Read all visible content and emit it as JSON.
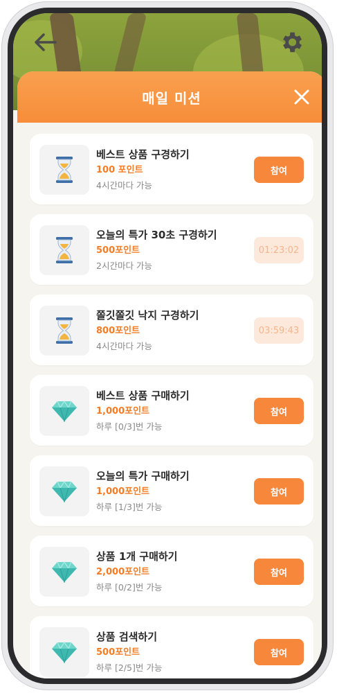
{
  "header": {
    "title": "매일 미션"
  },
  "missions": [
    {
      "icon": "hourglass",
      "title": "베스트 상품 구경하기",
      "points": "100 포인트",
      "availability": "4시간마다 가능",
      "action": "참여",
      "state": "join"
    },
    {
      "icon": "hourglass",
      "title": "오늘의 특가 30초 구경하기",
      "points": "500포인트",
      "availability": "2시간마다 가능",
      "action": "01:23:02",
      "state": "timer"
    },
    {
      "icon": "hourglass",
      "title": "쫄깃쫄깃 낙지 구경하기",
      "points": "800포인트",
      "availability": "4시간마다 가능",
      "action": "03:59:43",
      "state": "timer"
    },
    {
      "icon": "diamond",
      "title": "베스트 상품 구매하기",
      "points": "1,000포인트",
      "availability": "하루 [0/3]번 가능",
      "action": "참여",
      "state": "join"
    },
    {
      "icon": "diamond",
      "title": "오늘의 특가 구매하기",
      "points": "1,000포인트",
      "availability": "하루 [1/3]번 가능",
      "action": "참여",
      "state": "join"
    },
    {
      "icon": "diamond",
      "title": "상품 1개 구매하기",
      "points": "2,000포인트",
      "availability": "하루 [0/2]번 가능",
      "action": "참여",
      "state": "join"
    },
    {
      "icon": "diamond",
      "title": "상품 검색하기",
      "points": "500포인트",
      "availability": "하루 [2/5]번 가능",
      "action": "참여",
      "state": "join"
    }
  ],
  "colors": {
    "accent": "#f7873a",
    "points": "#f47c25",
    "timer_bg": "#fde9dc",
    "timer_text": "#f5b58c"
  }
}
